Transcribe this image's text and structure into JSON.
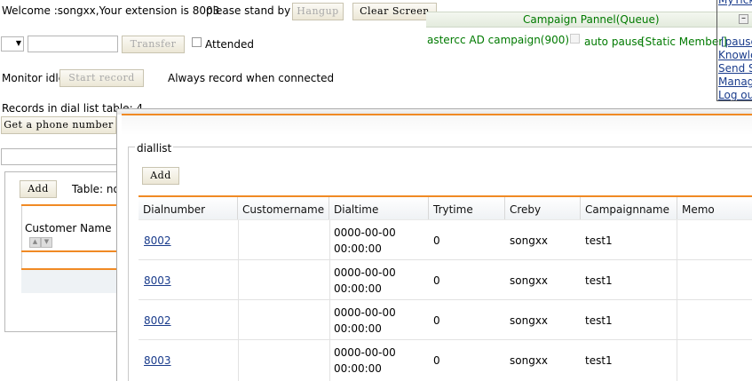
{
  "toolbar": {
    "welcome_text": "Welcome :songxx,Your extension is 8003",
    "status_text": "please stand by",
    "hangup_label": "Hangup",
    "clear_screen_label": "Clear Screen",
    "transfer_label": "Transfer",
    "attended_label": "Attended",
    "monitor_text": "Monitor idle",
    "start_record_label": "Start record",
    "always_record_text": "Always record when connected",
    "records_text": "Records in dial list table: 4",
    "get_phone_label": "Get a phone number"
  },
  "campaign_panel": {
    "title": "Campaign Pannel(Queue)",
    "campaign_name": "astercc AD campaign(900)",
    "auto_pause_label": "auto pause",
    "member_type": "[Static Member]",
    "pause_link": "[pause"
  },
  "side_links": [
    "MyTicke",
    "Knowle",
    "Send S",
    "Manage",
    "Log out"
  ],
  "left_panel": {
    "add_label": "Add",
    "table_label": "Table: no",
    "customer_name_header": "Customer Name"
  },
  "dialog": {
    "legend": "diallist",
    "add_label": "Add",
    "columns": [
      "Dialnumber",
      "Customername",
      "Dialtime",
      "Trytime",
      "Creby",
      "Campaignname",
      "Memo"
    ],
    "rows": [
      {
        "dialnumber": "8002",
        "customername": "",
        "dialtime_date": "0000-00-00",
        "dialtime_time": "00:00:00",
        "trytime": "0",
        "creby": "songxx",
        "campaignname": "test1",
        "memo": ""
      },
      {
        "dialnumber": "8003",
        "customername": "",
        "dialtime_date": "0000-00-00",
        "dialtime_time": "00:00:00",
        "trytime": "0",
        "creby": "songxx",
        "campaignname": "test1",
        "memo": ""
      },
      {
        "dialnumber": "8002",
        "customername": "",
        "dialtime_date": "0000-00-00",
        "dialtime_time": "00:00:00",
        "trytime": "0",
        "creby": "songxx",
        "campaignname": "test1",
        "memo": ""
      },
      {
        "dialnumber": "8003",
        "customername": "",
        "dialtime_date": "0000-00-00",
        "dialtime_time": "00:00:00",
        "trytime": "0",
        "creby": "songxx",
        "campaignname": "test1",
        "memo": ""
      }
    ]
  },
  "colors": {
    "accent_orange": "#f08a24",
    "campaign_green": "#007a00",
    "link_blue": "#1a3c8c"
  }
}
